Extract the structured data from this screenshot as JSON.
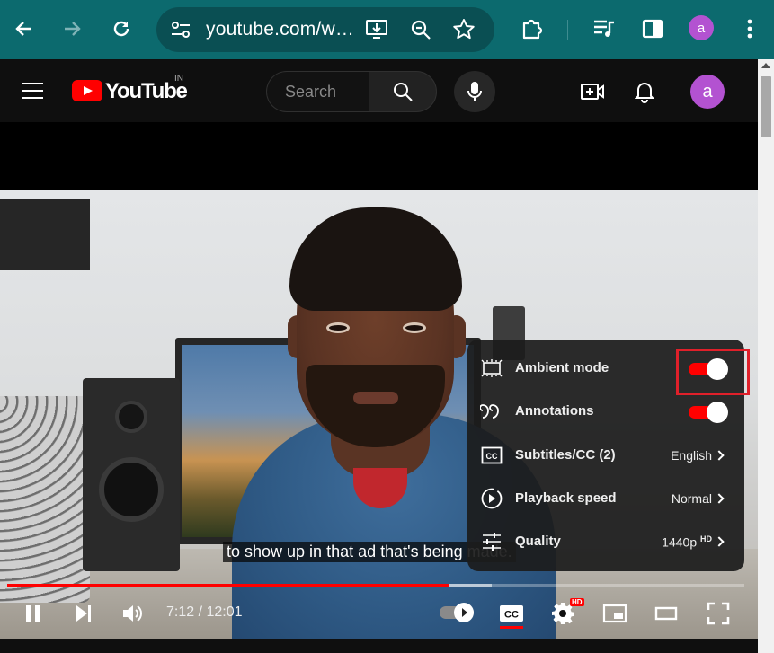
{
  "browser": {
    "url": "youtube.com/w…",
    "profile_initial": "a",
    "toolbar_color": "#0c6a6e"
  },
  "header": {
    "logo_text": "YouTube",
    "country_code": "IN",
    "search_placeholder": "Search",
    "avatar_initial": "a"
  },
  "video": {
    "subtitle": "to show up in that ad that's being made."
  },
  "settings_menu": {
    "items": [
      {
        "label": "Ambient mode",
        "type": "toggle",
        "on": true
      },
      {
        "label": "Annotations",
        "type": "toggle",
        "on": true
      },
      {
        "label": "Subtitles/CC (2)",
        "value": "English"
      },
      {
        "label": "Playback speed",
        "value": "Normal"
      },
      {
        "label": "Quality",
        "value": "1440p",
        "badge": "HD"
      }
    ]
  },
  "player": {
    "time_current": "7:12",
    "time_total": "12:01",
    "time_text": "7:12 / 12:01",
    "progress": 0.6,
    "buffered": 0.657,
    "settings_badge": "HD",
    "accent": "#ff0000"
  }
}
